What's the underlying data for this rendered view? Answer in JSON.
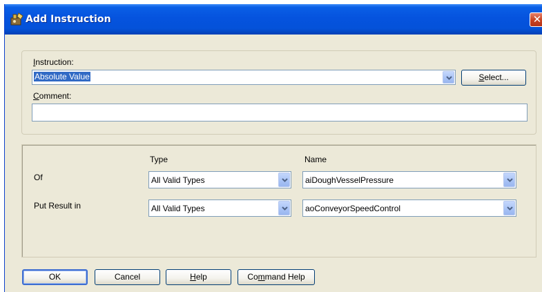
{
  "window": {
    "title": "Add Instruction",
    "close_label": "✕"
  },
  "instruction": {
    "label_accel": "I",
    "label_rest": "nstruction:",
    "value": "Absolute Value",
    "select_accel": "S",
    "select_rest": "elect..."
  },
  "comment": {
    "label_accel": "C",
    "label_rest": "omment:",
    "value": ""
  },
  "operands": {
    "type_header": "Type",
    "name_header": "Name",
    "rows": [
      {
        "label": "Of",
        "type": "All Valid Types",
        "name": "aiDoughVesselPressure"
      },
      {
        "label": "Put Result in",
        "type": "All Valid Types",
        "name": "aoConveyorSpeedControl"
      }
    ]
  },
  "buttons": {
    "ok": "OK",
    "cancel": "Cancel",
    "help_accel": "H",
    "help_rest": "elp",
    "command_help_pre": "Co",
    "command_help_accel": "m",
    "command_help_post": "mand Help"
  },
  "colors": {
    "title_bar": "#0553de",
    "dialog_bg": "#ece9d8",
    "selection": "#316ac5",
    "close_button": "#c8411f"
  }
}
